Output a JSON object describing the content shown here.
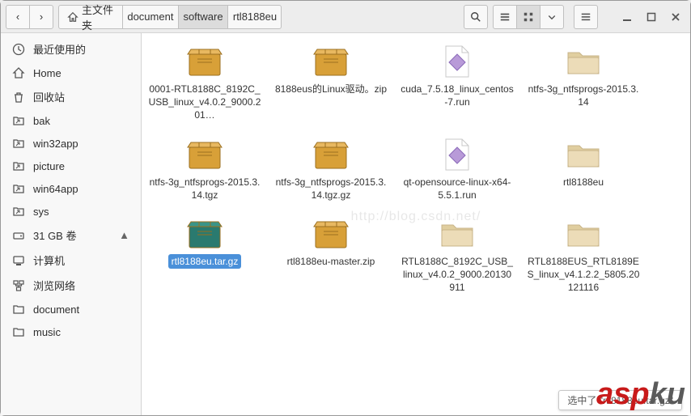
{
  "breadcrumb": {
    "home_label": "主文件夹",
    "items": [
      "document",
      "software",
      "rtl8188eu"
    ],
    "active_index": 1
  },
  "sidebar": {
    "items": [
      {
        "icon": "clock",
        "label": "最近使用的"
      },
      {
        "icon": "home",
        "label": "Home"
      },
      {
        "icon": "trash",
        "label": "回收站"
      },
      {
        "icon": "folder-link",
        "label": "bak"
      },
      {
        "icon": "folder-link",
        "label": "win32app"
      },
      {
        "icon": "folder-link",
        "label": "picture"
      },
      {
        "icon": "folder-link",
        "label": "win64app"
      },
      {
        "icon": "folder-link",
        "label": "sys"
      },
      {
        "icon": "disk",
        "label": "31 GB 卷",
        "ejectable": true
      },
      {
        "icon": "computer",
        "label": "计算机"
      },
      {
        "icon": "network",
        "label": "浏览网络"
      },
      {
        "icon": "folder",
        "label": "document"
      },
      {
        "icon": "folder",
        "label": "music"
      }
    ]
  },
  "files": [
    {
      "type": "package",
      "name": "0001-RTL8188C_8192C_USB_linux_v4.0.2_9000.201…",
      "selected": false
    },
    {
      "type": "package",
      "name": "8188eus的Linux驱动。zip",
      "selected": false
    },
    {
      "type": "run",
      "name": "cuda_7.5.18_linux_centos-7.run",
      "selected": false
    },
    {
      "type": "folder",
      "name": "ntfs-3g_ntfsprogs-2015.3.14",
      "selected": false
    },
    {
      "type": "package",
      "name": "ntfs-3g_ntfsprogs-2015.3.14.tgz",
      "selected": false
    },
    {
      "type": "package",
      "name": "ntfs-3g_ntfsprogs-2015.3.14.tgz.gz",
      "selected": false
    },
    {
      "type": "run",
      "name": "qt-opensource-linux-x64-5.5.1.run",
      "selected": false
    },
    {
      "type": "folder",
      "name": "rtl8188eu",
      "selected": false
    },
    {
      "type": "package",
      "name": "rtl8188eu.tar.gz",
      "selected": true
    },
    {
      "type": "package",
      "name": "rtl8188eu-master.zip",
      "selected": false
    },
    {
      "type": "folder",
      "name": "RTL8188C_8192C_USB_linux_v4.0.2_9000.20130911",
      "selected": false
    },
    {
      "type": "folder",
      "name": "RTL8188EUS_RTL8189ES_linux_v4.1.2.2_5805.20121116",
      "selected": false
    }
  ],
  "status": {
    "text": "选中了 \"rtl8188eu.tar.gz\""
  },
  "watermark_center": "http://blog.csdn.net/",
  "watermark_corner": {
    "a": "asp",
    "b": "ku"
  }
}
